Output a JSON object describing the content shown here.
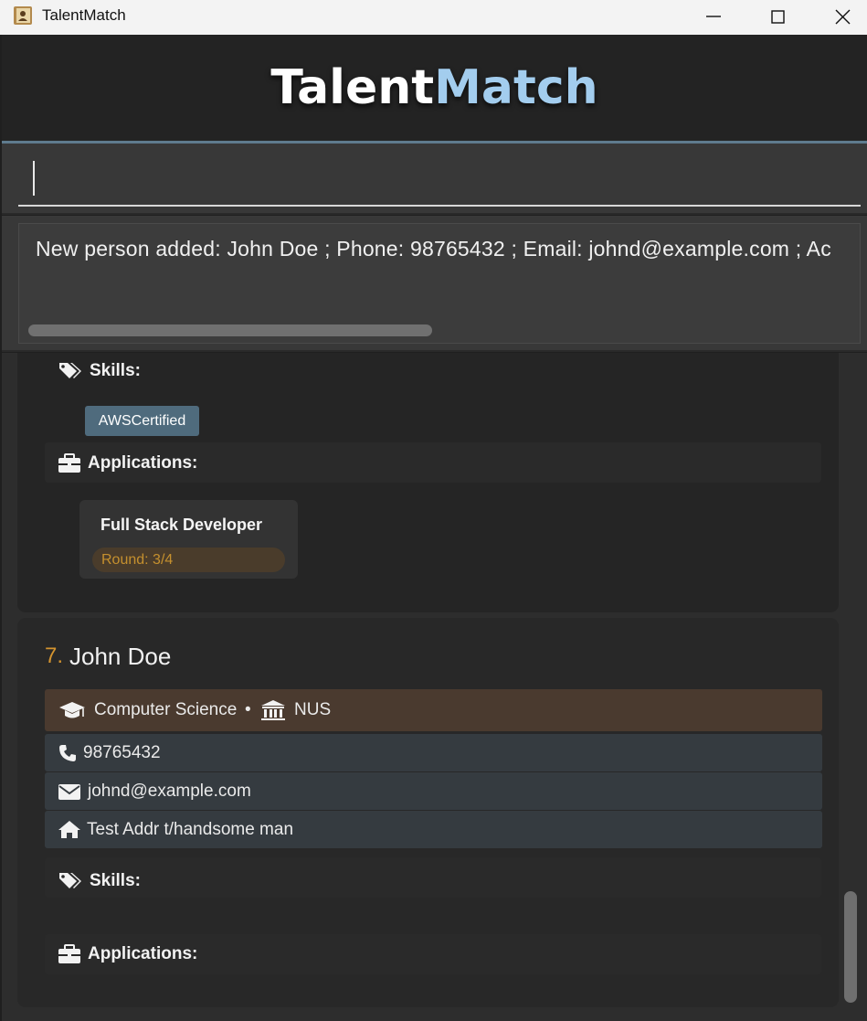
{
  "window": {
    "title": "TalentMatch"
  },
  "header": {
    "brand_a": "Talent",
    "brand_b": "Match"
  },
  "command": {
    "value": "",
    "placeholder": ""
  },
  "result": {
    "text": "New person added: John Doe ; Phone: 98765432 ; Email: johnd@example.com ; Ac"
  },
  "cards": [
    {
      "skills_label": "Skills:",
      "skills": [
        "AWSCertified"
      ],
      "applications_label": "Applications:",
      "applications": [
        {
          "title": "Full Stack Developer",
          "round": "Round: 3/4"
        }
      ]
    },
    {
      "index": "7.",
      "name": "John Doe",
      "major": "Computer Science",
      "separator": "•",
      "university": "NUS",
      "phone": "98765432",
      "email": "johnd@example.com",
      "address": "Test Addr t/handsome man",
      "skills_label": "Skills:",
      "applications_label": "Applications:"
    }
  ],
  "colors": {
    "accent": "#a3cdee",
    "index": "#d4942f",
    "tag": "#4f6b7d",
    "round": "#c5902e"
  },
  "icons": [
    "app-icon",
    "minimize-icon",
    "maximize-icon",
    "close-icon",
    "tags-icon",
    "briefcase-icon",
    "graduation-cap-icon",
    "university-icon",
    "phone-icon",
    "envelope-icon",
    "home-icon"
  ]
}
